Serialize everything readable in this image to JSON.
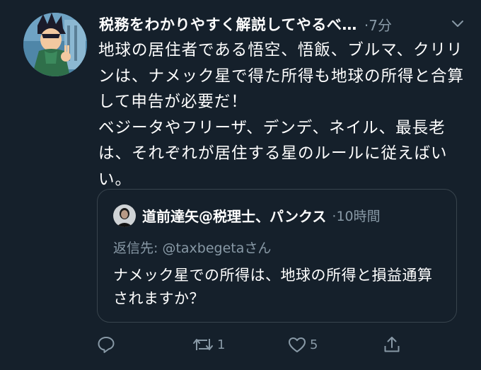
{
  "tweet": {
    "display_name": "税務をわかりやすく解説してやるべ…",
    "time": "·7分",
    "text": "地球の居住者である悟空、悟飯、ブルマ、クリリンは、ナメック星で得た所得も地球の所得と合算して申告が必要だ！\nベジータやフリーザ、デンデ、ネイル、最長老は、それぞれが居住する星のルールに従えばいい。",
    "avatar_icon": "vegeta-avatar",
    "caret_icon": "chevron-down-icon"
  },
  "quote": {
    "display_name": "道前達矢@税理士、パンクス",
    "time": "·10時間",
    "reply_to": "返信先: @taxbegetaさん",
    "text": "ナメック星での所得は、地球の所得と損益通算されますか？"
  },
  "actions": {
    "reply_count": "",
    "retweet_count": "1",
    "like_count": "5",
    "share_count": ""
  },
  "colors": {
    "background": "#15202b",
    "text": "#ffffff",
    "muted": "#8899a6",
    "border": "#38444d"
  }
}
